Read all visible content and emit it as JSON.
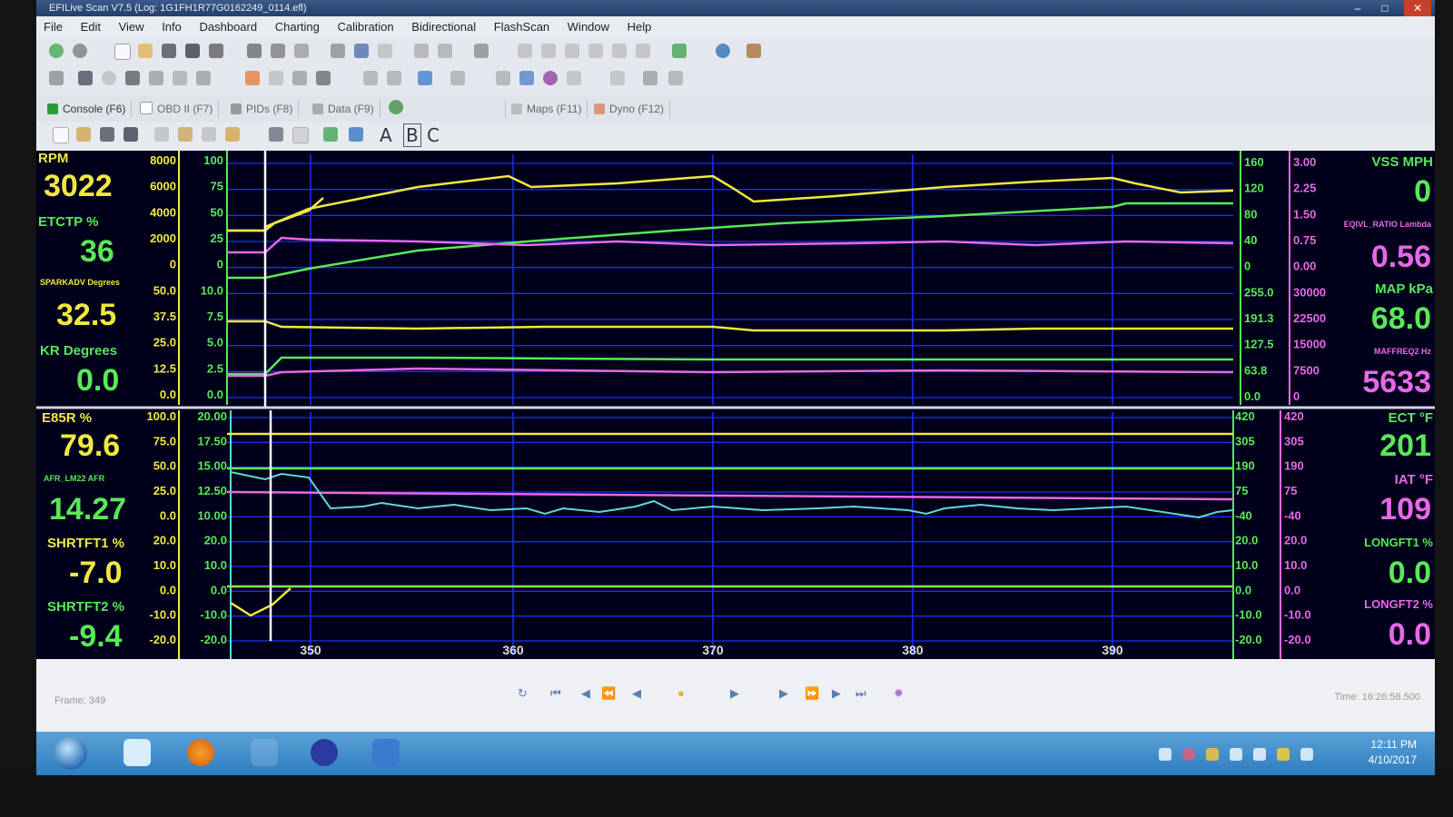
{
  "window": {
    "title": "EFILive Scan V7.5 (Log: 1G1FH1R77G0162249_0114.efl)"
  },
  "menu": [
    "File",
    "Edit",
    "View",
    "Info",
    "Dashboard",
    "Charting",
    "Calibration",
    "Bidirectional",
    "FlashScan",
    "Window",
    "Help"
  ],
  "tabs": [
    "Console (F6)",
    "OBD II (F7)",
    "PIDs (F8)",
    "Data (F9)",
    "Maps (F11)",
    "Dyno (F12)"
  ],
  "format_letters": [
    "A",
    "B",
    "C"
  ],
  "upper_panel": {
    "left_params": [
      {
        "name": "RPM",
        "value": "3022"
      },
      {
        "name": "ETCTP %",
        "value": "36"
      },
      {
        "name": "SPARKADV Degrees",
        "value": "32.5"
      },
      {
        "name": "KR Degrees",
        "value": "0.0"
      }
    ],
    "left_scale_a": [
      "8000",
      "6000",
      "4000",
      "2000",
      "0",
      "50.0",
      "37.5",
      "25.0",
      "12.5",
      "0.0"
    ],
    "left_scale_b": [
      "100",
      "75",
      "50",
      "25",
      "0",
      "10.0",
      "7.5",
      "5.0",
      "2.5",
      "0.0"
    ],
    "right_scale_a": [
      "160",
      "120",
      "80",
      "40",
      "0",
      "255.0",
      "191.3",
      "127.5",
      "63.8",
      "0.0"
    ],
    "right_scale_b": [
      "3.00",
      "2.25",
      "1.50",
      "0.75",
      "0.00",
      "30000",
      "22500",
      "15000",
      "7500",
      "0"
    ],
    "right_params": [
      {
        "name": "VSS MPH",
        "value": "0"
      },
      {
        "name": "EQIVL_RATIO Lambda",
        "value": "0.56"
      },
      {
        "name": "MAP kPa",
        "value": "68.0"
      },
      {
        "name": "MAFFREQ2 Hz",
        "value": "5633"
      }
    ]
  },
  "lower_panel": {
    "left_params": [
      {
        "name": "E85R %",
        "value": "79.6"
      },
      {
        "name": "AFR_LM22 AFR",
        "value": "14.27"
      },
      {
        "name": "SHRTFT1 %",
        "value": "-7.0"
      },
      {
        "name": "SHRTFT2 %",
        "value": "-9.4"
      }
    ],
    "left_scale_a": [
      "100.0",
      "75.0",
      "50.0",
      "25.0",
      "0.0",
      "20.0",
      "10.0",
      "0.0",
      "-10.0",
      "-20.0"
    ],
    "left_scale_b": [
      "20.00",
      "17.50",
      "15.00",
      "12.50",
      "10.00",
      "20.0",
      "10.0",
      "0.0",
      "-10.0",
      "-20.0"
    ],
    "right_scale_a": [
      "420",
      "305",
      "190",
      "75",
      "-40",
      "20.0",
      "10.0",
      "0.0",
      "-10.0",
      "-20.0"
    ],
    "right_scale_b": [
      "420",
      "305",
      "190",
      "75",
      "-40",
      "20.0",
      "10.0",
      "0.0",
      "-10.0",
      "-20.0"
    ],
    "right_params": [
      {
        "name": "ECT °F",
        "value": "201"
      },
      {
        "name": "IAT °F",
        "value": "109"
      },
      {
        "name": "LONGFT1 %",
        "value": "0.0"
      },
      {
        "name": "LONGFT2 %",
        "value": "0.0"
      }
    ]
  },
  "time_axis": [
    "350",
    "360",
    "370",
    "380",
    "390"
  ],
  "status": {
    "frame": "Frame: 349",
    "time": "Time: 16:26:58.500"
  },
  "clock": {
    "time": "12:11 PM",
    "date": "4/10/2017"
  },
  "colors": {
    "yellow": "#f0e840",
    "green": "#58e858",
    "magenta": "#e868e8",
    "cyan": "#60d8d8",
    "grid": "#1c2cff",
    "bg": "#00001a"
  }
}
